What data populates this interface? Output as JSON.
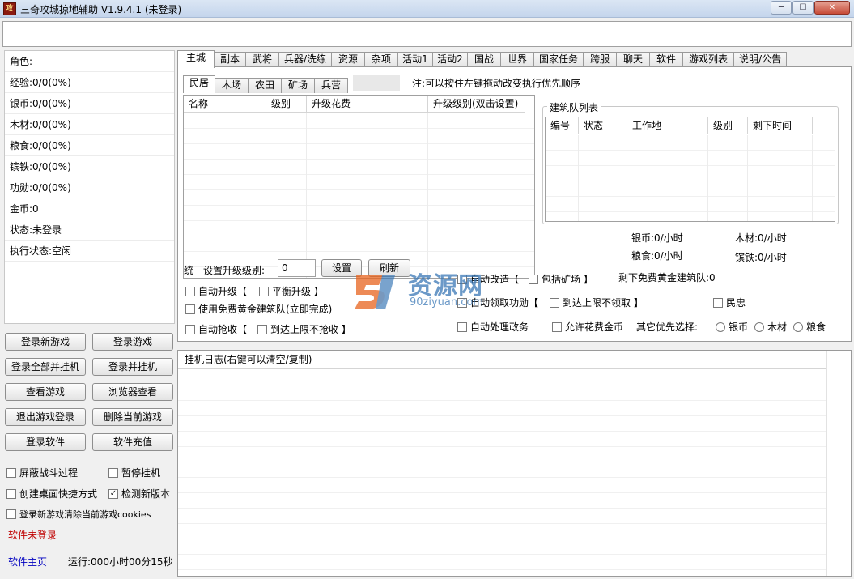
{
  "window": {
    "title": "三奇攻城掠地辅助 V1.9.4.1 (未登录)",
    "icon_text": "攻",
    "min": "─",
    "max": "☐",
    "close": "✕"
  },
  "top_input": {
    "value": ""
  },
  "info": [
    "角色:",
    "经验:0/0(0%)",
    "银币:0/0(0%)",
    "木材:0/0(0%)",
    "粮食:0/0(0%)",
    "镔铁:0/0(0%)",
    "功勋:0/0(0%)",
    "金币:0",
    "状态:未登录",
    "执行状态:空闲"
  ],
  "left_buttons": [
    "登录新游戏",
    "登录游戏",
    "登录全部并挂机",
    "登录并挂机",
    "查看游戏",
    "浏览器查看",
    "退出游戏登录",
    "删除当前游戏",
    "登录软件",
    "软件充值"
  ],
  "left_checks": [
    {
      "label": "屏蔽战斗过程",
      "checked": false
    },
    {
      "label": "暂停挂机",
      "checked": false
    },
    {
      "label": "创建桌面快捷方式",
      "checked": false
    },
    {
      "label": "检测新版本",
      "checked": true
    },
    {
      "label": "登录新游戏清除当前游戏cookies",
      "checked": false
    }
  ],
  "status": {
    "software_login": "软件未登录",
    "homepage": "软件主页",
    "runtime": "运行:000小时00分15秒"
  },
  "colors": {
    "status_red": "#c00000",
    "link_blue": "#0000c0",
    "watermark_blue": "#3a78b6",
    "watermark_orange": "#e8641e"
  },
  "main_tabs": [
    "主城",
    "副本",
    "武将",
    "兵器/洗练",
    "资源",
    "杂项",
    "活动1",
    "活动2",
    "国战",
    "世界",
    "国家任务",
    "跨服",
    "聊天",
    "软件",
    "游戏列表",
    "说明/公告"
  ],
  "sub_tabs": [
    "民居",
    "木场",
    "农田",
    "矿场",
    "兵营"
  ],
  "note": "注:可以按住左键拖动改变执行优先顺序",
  "upgrade_table": {
    "columns": [
      "名称",
      "级别",
      "升级花费",
      "升级级别(双击设置)"
    ]
  },
  "build_queue": {
    "title": "建筑队列表",
    "columns": [
      "编号",
      "状态",
      "工作地",
      "级别",
      "剩下时间"
    ]
  },
  "rates": {
    "silver": "银币:0/小时",
    "wood": "木材:0/小时",
    "food": "粮食:0/小时",
    "iron": "镔铁:0/小时"
  },
  "unify": {
    "label": "统一设置升级级别:",
    "value": "0",
    "set_btn": "设置",
    "refresh_btn": "刷新"
  },
  "main_checks": {
    "auto_upgrade": "自动升级【",
    "balance_upgrade": "平衡升级 】",
    "free_gold_team": "使用免费黄金建筑队(立即完成)",
    "auto_rob": "自动抢收【",
    "rob_limit": "到达上限不抢收 】",
    "auto_reform": "自动改造【",
    "include_mine": "包括矿场 】",
    "auto_merit": "自动领取功勋【",
    "merit_limit": "到达上限不领取 】",
    "auto_affairs": "自动处理政务",
    "allow_gold": "允许花费金币",
    "minzhong": "民忠"
  },
  "free_gold_left": "剩下免费黄金建筑队:0",
  "priority": {
    "label": "其它优先选择:",
    "options": [
      "银币",
      "木材",
      "粮食"
    ]
  },
  "watermark": {
    "cn": "资源网",
    "en": "90ziyuan.com"
  },
  "log": {
    "title": "挂机日志(右键可以清空/复制)"
  }
}
